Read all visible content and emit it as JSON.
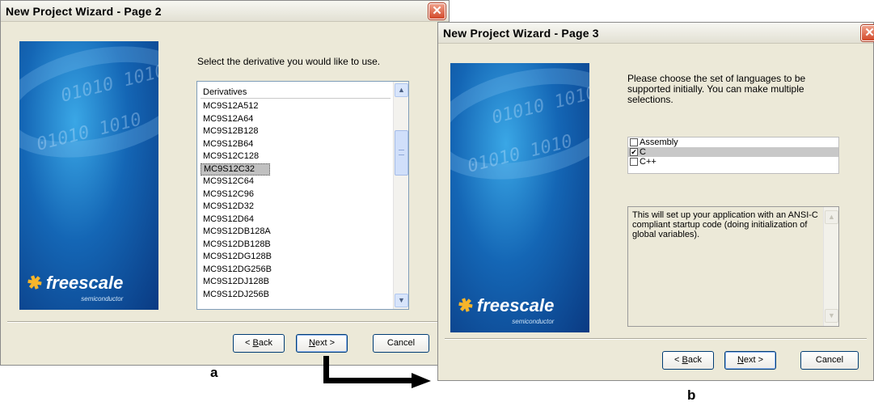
{
  "window_a": {
    "title": "New Project Wizard - Page  2",
    "close": "✕",
    "prompt": "Select the derivative you would like to use.",
    "list_header": "Derivatives",
    "items": [
      "MC9S12A512",
      "MC9S12A64",
      "MC9S12B128",
      "MC9S12B64",
      "MC9S12C128",
      "MC9S12C32",
      "MC9S12C64",
      "MC9S12C96",
      "MC9S12D32",
      "MC9S12D64",
      "MC9S12DB128A",
      "MC9S12DB128B",
      "MC9S12DG128B",
      "MC9S12DG256B",
      "MC9S12DJ128B",
      "MC9S12DJ256B"
    ],
    "selected_item": "MC9S12C32",
    "buttons": {
      "back_pre": "< ",
      "back_key": "B",
      "back_post": "ack",
      "next_key": "N",
      "next_post": "ext >",
      "cancel": "Cancel"
    },
    "caption": "a",
    "logo": {
      "name": "freescale",
      "sub": "semiconductor",
      "binary": "01010 1010"
    }
  },
  "window_b": {
    "title": "New Project Wizard - Page  3",
    "close": "✕",
    "prompt": "Please choose the set of languages to be supported initially. You can make multiple selections.",
    "languages": [
      {
        "label": "Assembly",
        "mark": ""
      },
      {
        "label": "C",
        "mark": "✔"
      },
      {
        "label": "C++",
        "mark": ""
      }
    ],
    "description": "This will set up your application with an ANSI-C compliant startup code (doing initialization of global variables).",
    "buttons": {
      "back_pre": "< ",
      "back_key": "B",
      "back_post": "ack",
      "next_key": "N",
      "next_post": "ext >",
      "cancel": "Cancel"
    },
    "caption": "b",
    "logo": {
      "name": "freescale",
      "sub": "semiconductor",
      "binary": "01010 1010"
    }
  },
  "colors": {
    "banner": "#1466b5",
    "dialog": "#ece9d8",
    "logo_mark": "#f6b52a"
  }
}
